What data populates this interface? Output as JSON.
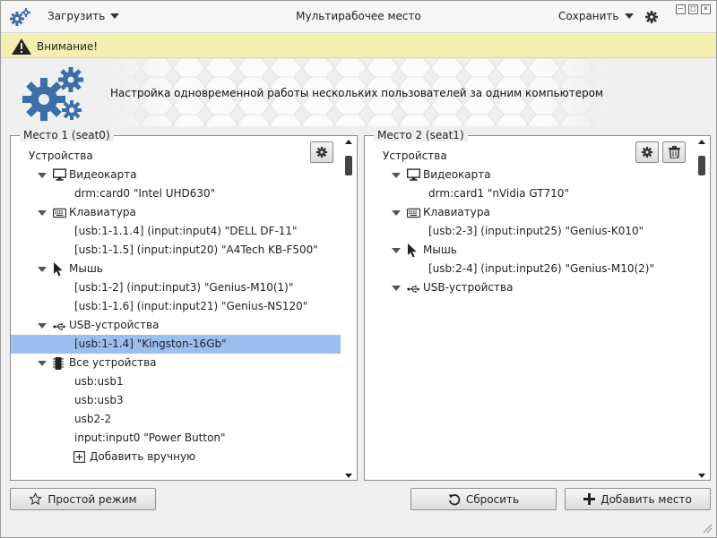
{
  "titlebar": {
    "load_label": "Загрузить",
    "title": "Мультирабочее место",
    "save_label": "Сохранить",
    "window_buttons": [
      "–",
      "□",
      "×"
    ]
  },
  "warning": {
    "text": "Внимание!"
  },
  "header": {
    "text": "Настройка одновременной работы нескольких пользователей за одним компьютером"
  },
  "seats": [
    {
      "title": "Место 1 (seat0)",
      "tools": [
        "gear-icon"
      ],
      "rows": [
        {
          "label": "Устройства",
          "indent": 0,
          "arrow": false,
          "icon": null,
          "selected": false
        },
        {
          "label": "Видеокарта",
          "indent": 1,
          "arrow": true,
          "icon": "monitor-icon",
          "selected": false
        },
        {
          "label": "drm:card0 \"Intel UHD630\"",
          "indent": 2,
          "arrow": false,
          "icon": null,
          "selected": false
        },
        {
          "label": "Клавиатура",
          "indent": 1,
          "arrow": true,
          "icon": "keyboard-icon",
          "selected": false
        },
        {
          "label": "[usb:1-1.1.4] (input:input4) \"DELL DF-11\"",
          "indent": 2,
          "arrow": false,
          "icon": null,
          "selected": false
        },
        {
          "label": "[usb:1-1.5] (input:input20) \"A4Tech KB-F500\"",
          "indent": 2,
          "arrow": false,
          "icon": null,
          "selected": false
        },
        {
          "label": "Мышь",
          "indent": 1,
          "arrow": true,
          "icon": "cursor-icon",
          "selected": false
        },
        {
          "label": "[usb:1-2] (input:input3) \"Genius-M10(1)\"",
          "indent": 2,
          "arrow": false,
          "icon": null,
          "selected": false
        },
        {
          "label": "[usb:1-1.6] (input:input21) \"Genius-NS120\"",
          "indent": 2,
          "arrow": false,
          "icon": null,
          "selected": false
        },
        {
          "label": "USB-устройства",
          "indent": 1,
          "arrow": true,
          "icon": "usb-icon",
          "selected": false
        },
        {
          "label": "[usb:1-1.4] \"Kingston-16Gb\"",
          "indent": 2,
          "arrow": false,
          "icon": null,
          "selected": true
        },
        {
          "label": "Все устройства",
          "indent": 1,
          "arrow": true,
          "icon": "chip-icon",
          "selected": false
        },
        {
          "label": "usb:usb1",
          "indent": 2,
          "arrow": false,
          "icon": null,
          "selected": false
        },
        {
          "label": "usb:usb3",
          "indent": 2,
          "arrow": false,
          "icon": null,
          "selected": false
        },
        {
          "label": "usb2-2",
          "indent": 2,
          "arrow": false,
          "icon": null,
          "selected": false
        },
        {
          "label": "input:input0 \"Power Button\"",
          "indent": 2,
          "arrow": false,
          "icon": null,
          "selected": false
        },
        {
          "label": "Добавить вручную",
          "indent": 2,
          "arrow": false,
          "icon": "plus-box-icon",
          "selected": false
        }
      ]
    },
    {
      "title": "Место 2 (seat1)",
      "tools": [
        "gear-icon",
        "trash-icon"
      ],
      "rows": [
        {
          "label": "Устройства",
          "indent": 0,
          "arrow": false,
          "icon": null,
          "selected": false
        },
        {
          "label": "Видеокарта",
          "indent": 1,
          "arrow": true,
          "icon": "monitor-icon",
          "selected": false
        },
        {
          "label": "drm:card1 \"nVidia GT710\"",
          "indent": 2,
          "arrow": false,
          "icon": null,
          "selected": false
        },
        {
          "label": "Клавиатура",
          "indent": 1,
          "arrow": true,
          "icon": "keyboard-icon",
          "selected": false
        },
        {
          "label": "[usb:2-3] (input:input25) \"Genius-K010\"",
          "indent": 2,
          "arrow": false,
          "icon": null,
          "selected": false
        },
        {
          "label": "Мышь",
          "indent": 1,
          "arrow": true,
          "icon": "cursor-icon",
          "selected": false
        },
        {
          "label": "[usb:2-4] (input:input26) \"Genius-M10(2)\"",
          "indent": 2,
          "arrow": false,
          "icon": null,
          "selected": false
        },
        {
          "label": "USB-устройства",
          "indent": 1,
          "arrow": true,
          "icon": "usb-icon",
          "selected": false
        }
      ]
    }
  ],
  "buttons": {
    "simple_mode": "Простой режим",
    "reset": "Сбросить",
    "add_seat": "Добавить место"
  },
  "colors": {
    "selection": "#9bbff0",
    "warning_bg": "#f3efb3",
    "gear_blue": "#3d6ea8"
  }
}
